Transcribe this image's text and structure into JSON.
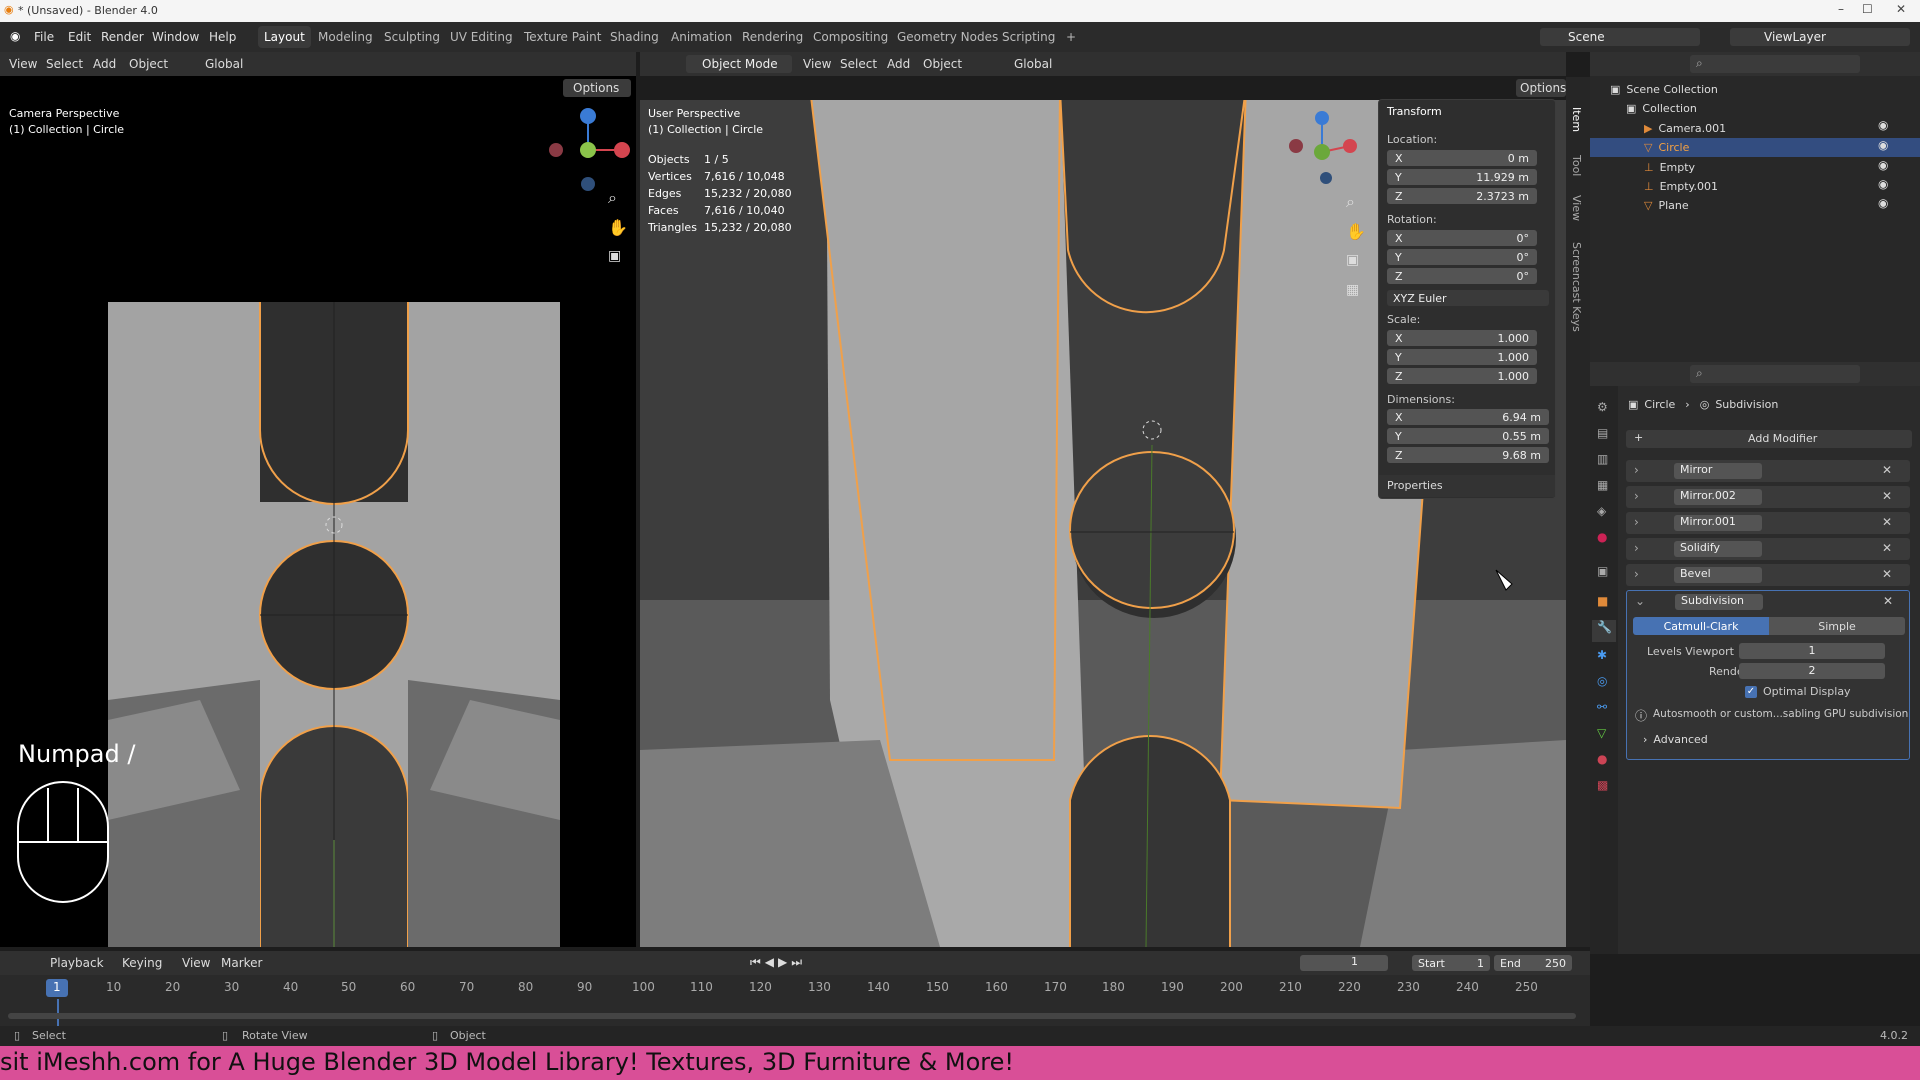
{
  "window": {
    "title": "* (Unsaved) - Blender 4.0",
    "controls": [
      "–",
      "☐",
      "✕"
    ]
  },
  "menu": {
    "items": [
      "File",
      "Edit",
      "Render",
      "Window",
      "Help"
    ]
  },
  "workspaces": [
    "Layout",
    "Modeling",
    "Sculpting",
    "UV Editing",
    "Texture Paint",
    "Shading",
    "Animation",
    "Rendering",
    "Compositing",
    "Geometry Nodes",
    "Scripting",
    "+"
  ],
  "topright": {
    "scene": "Scene",
    "viewlayer": "ViewLayer"
  },
  "left_view": {
    "menus": [
      "View",
      "Select",
      "Add",
      "Object"
    ],
    "orient": "Global",
    "options": "Options",
    "title": "Camera Perspective",
    "collection": "(1) Collection | Circle",
    "key_hint": "Numpad /"
  },
  "main_view": {
    "mode": "Object Mode",
    "menus": [
      "View",
      "Select",
      "Add",
      "Object"
    ],
    "orient": "Global",
    "options": "Options",
    "title": "User Perspective",
    "collection": "(1) Collection | Circle",
    "stats": [
      [
        "Objects",
        "1 / 5"
      ],
      [
        "Vertices",
        "7,616 / 10,048"
      ],
      [
        "Edges",
        "15,232 / 20,080"
      ],
      [
        "Faces",
        "7,616 / 10,040"
      ],
      [
        "Triangles",
        "15,232 / 20,080"
      ]
    ]
  },
  "gizmo_axes": [
    "X",
    "Y",
    "Z"
  ],
  "npanel": {
    "header": "Transform",
    "location_label": "Location:",
    "location": [
      [
        "X",
        "0 m"
      ],
      [
        "Y",
        "11.929 m"
      ],
      [
        "Z",
        "2.3723 m"
      ]
    ],
    "rotation_label": "Rotation:",
    "rotation": [
      [
        "X",
        "0°"
      ],
      [
        "Y",
        "0°"
      ],
      [
        "Z",
        "0°"
      ]
    ],
    "rotation_mode": "XYZ Euler",
    "scale_label": "Scale:",
    "scale": [
      [
        "X",
        "1.000"
      ],
      [
        "Y",
        "1.000"
      ],
      [
        "Z",
        "1.000"
      ]
    ],
    "dimensions_label": "Dimensions:",
    "dimensions": [
      [
        "X",
        "6.94 m"
      ],
      [
        "Y",
        "0.55 m"
      ],
      [
        "Z",
        "9.68 m"
      ]
    ],
    "properties": "Properties",
    "tabs": [
      "Item",
      "Tool",
      "View",
      "Screencast Keys"
    ]
  },
  "outliner": {
    "root": "Scene Collection",
    "collection": "Collection",
    "items": [
      "Camera.001",
      "Circle",
      "Empty",
      "Empty.001",
      "Plane"
    ]
  },
  "properties": {
    "breadcrumb_object": "Circle",
    "breadcrumb_modifier": "Subdivision",
    "add_modifier": "Add Modifier",
    "modifiers": [
      "Mirror",
      "Mirror.002",
      "Mirror.001",
      "Solidify",
      "Bevel",
      "Subdivision"
    ],
    "subdiv_types": [
      "Catmull-Clark",
      "Simple"
    ],
    "levels_viewport_label": "Levels Viewport",
    "levels_viewport": "1",
    "render_label": "Render",
    "render": "2",
    "optimal_display": "Optimal Display",
    "info": "Autosmooth or custom...sabling GPU subdivision",
    "advanced": "Advanced"
  },
  "timeline": {
    "menus": [
      "Playback",
      "Keying",
      "View",
      "Marker"
    ],
    "current_frame": "1",
    "start_label": "Start",
    "start": "1",
    "end_label": "End",
    "end": "250",
    "ticks": [
      "1",
      "10",
      "20",
      "30",
      "40",
      "50",
      "60",
      "70",
      "80",
      "90",
      "100",
      "110",
      "120",
      "130",
      "140",
      "150",
      "160",
      "170",
      "180",
      "190",
      "200",
      "210",
      "220",
      "230",
      "240",
      "250"
    ]
  },
  "status": {
    "select": "Select",
    "rotate": "Rotate View",
    "object": "Object",
    "version": "4.0.2"
  },
  "banner": "sit iMeshh.com for A Huge Blender 3D Model Library! Textures, 3D Furniture & More!",
  "colors": {
    "accent": "#4772b3",
    "outline": "#f5a142",
    "x_axis": "#d4454f",
    "y_axis": "#8bc34a",
    "z_axis": "#3a7bd5"
  }
}
